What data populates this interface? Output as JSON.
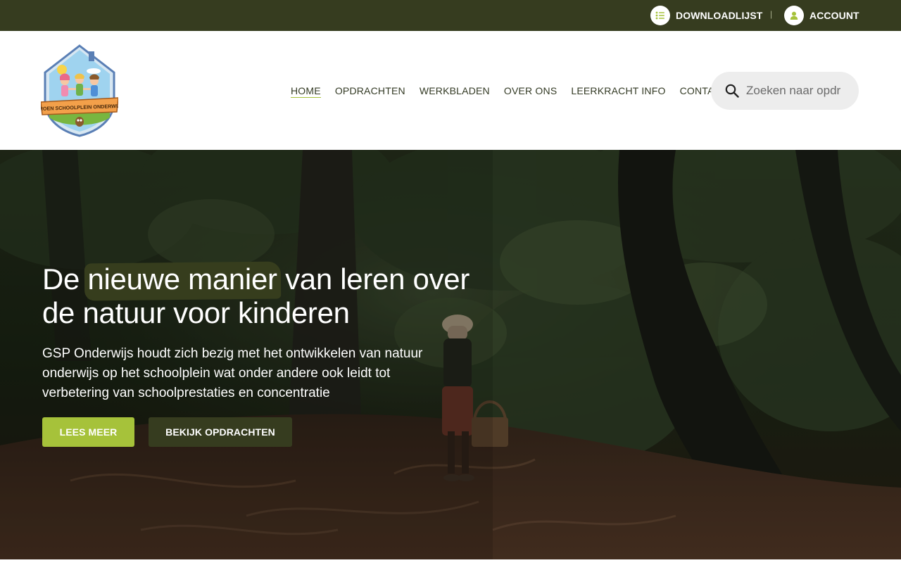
{
  "topbar": {
    "download_label": "DOWNLOADLIJST",
    "download_icon": "list-icon",
    "separator": "|",
    "account_label": "ACCOUNT",
    "account_icon": "user-icon",
    "background": "#363c1f"
  },
  "header": {
    "logo_text": "GROEN SCHOOLPLEIN ONDERWIJS",
    "nav": [
      "HOME",
      "OPDRACHTEN",
      "WERKBLADEN",
      "OVER ONS",
      "LEERKRACHT INFO",
      "CONTACT"
    ],
    "active_nav": "HOME",
    "search_placeholder": "Zoeken naar opdr",
    "search_icon": "search-icon"
  },
  "hero": {
    "title_pre": "De ",
    "title_highlight": "nieuwe manier",
    "title_post": " van leren over de natuur voor kinderen",
    "text": "GSP Onderwijs houdt zich bezig met het ontwikkelen van natuur onderwijs op het schoolplein wat onder andere ook leidt tot verbetering van schoolprestaties en concentratie",
    "primary_button": "LEES MEER",
    "secondary_button": "BEKIJK OPDRACHTEN"
  },
  "colors": {
    "accent": "#a6c23a",
    "dark_green": "#363c1f",
    "white": "#ffffff"
  }
}
